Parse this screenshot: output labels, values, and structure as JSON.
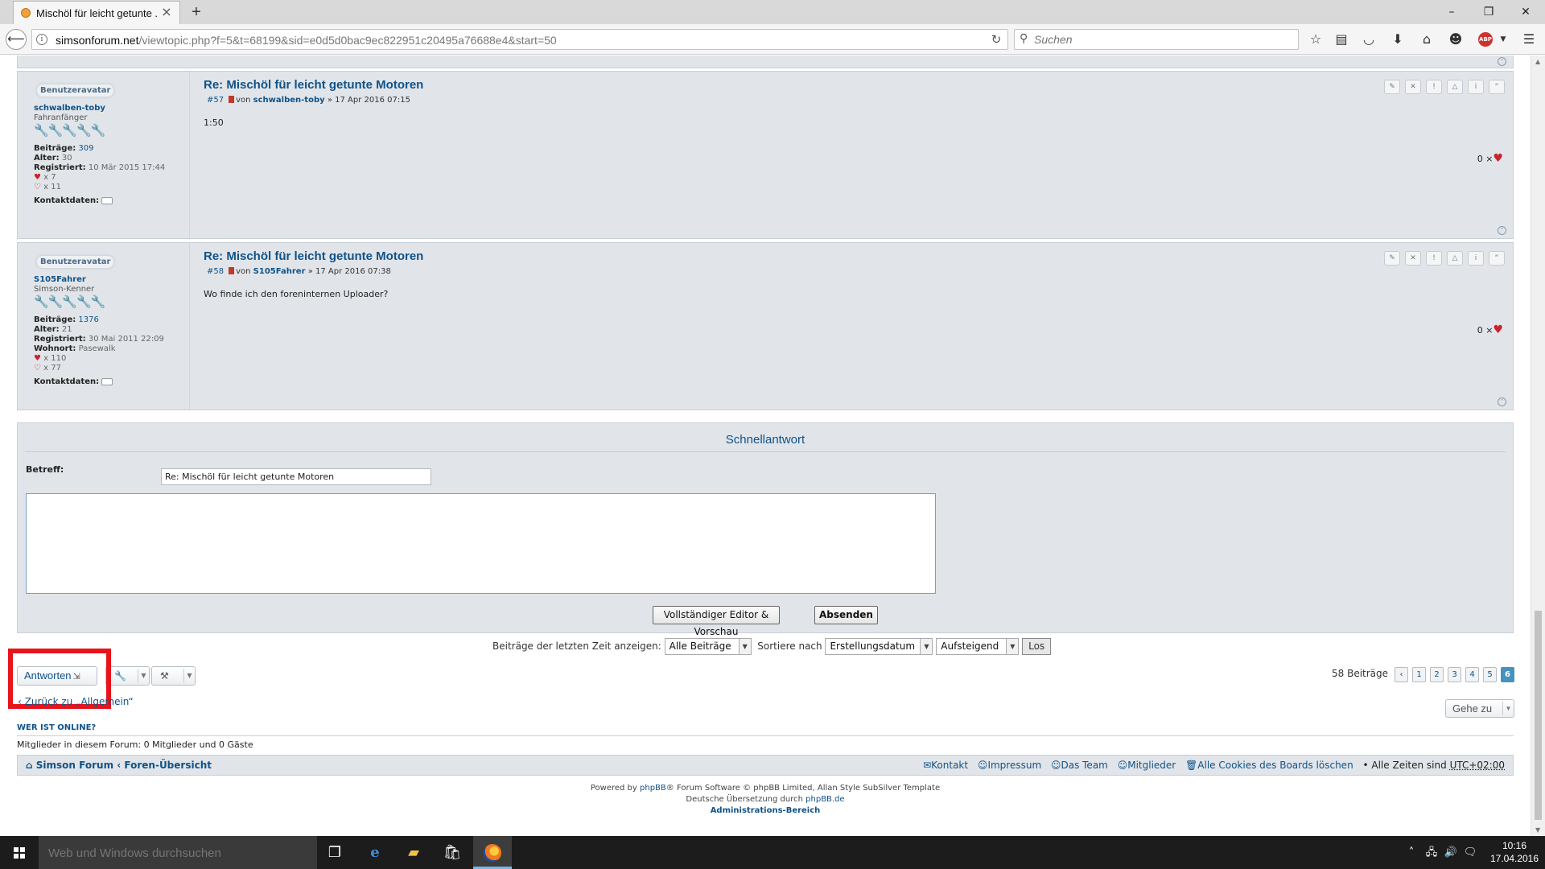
{
  "browser": {
    "tab_title": "Mischöl für leicht getunte ...",
    "url_host": "simsonforum.net",
    "url_path": "/viewtopic.php?f=5&t=68199&sid=e0d5d0bac9ec822951c20495a76688e4&start=50",
    "search_placeholder": "Suchen"
  },
  "posts": [
    {
      "avatar_label": "Benutzeravatar",
      "username": "schwalben-toby",
      "rank": "Fahranfänger",
      "rank_level": 2,
      "rank_max": 5,
      "beitraege_label": "Beiträge:",
      "beitraege": "309",
      "alter_label": "Alter:",
      "alter": "30",
      "registriert_label": "Registriert:",
      "registriert": "10 Mär 2015 17:44",
      "likes_given": "x 7",
      "likes_received": "x 11",
      "kontakt_label": "Kontaktdaten:",
      "title": "Re: Mischöl für leicht getunte Motoren",
      "number": "#57",
      "von": "von",
      "author": "schwalben-toby",
      "date": "» 17 Apr 2016 07:15",
      "body": "1:50",
      "like_count": "0 ×"
    },
    {
      "avatar_label": "Benutzeravatar",
      "username": "S105Fahrer",
      "rank": "Simson-Kenner",
      "rank_level": 4,
      "rank_max": 5,
      "beitraege_label": "Beiträge:",
      "beitraege": "1376",
      "alter_label": "Alter:",
      "alter": "21",
      "registriert_label": "Registriert:",
      "registriert": "30 Mai 2011 22:09",
      "wohnort_label": "Wohnort:",
      "wohnort": "Pasewalk",
      "likes_given": "x 110",
      "likes_received": "x 77",
      "kontakt_label": "Kontaktdaten:",
      "title": "Re: Mischöl für leicht getunte Motoren",
      "number": "#58",
      "von": "von",
      "author": "S105Fahrer",
      "date": "» 17 Apr 2016 07:38",
      "body": "Wo finde ich den foreninternen Uploader?",
      "like_count": "0 ×"
    }
  ],
  "quick_reply": {
    "title": "Schnellantwort",
    "subject_label": "Betreff:",
    "subject_value": "Re: Mischöl für leicht getunte Motoren",
    "message_value": "",
    "full_editor_label": "Vollständiger Editor & Vorschau",
    "submit_label": "Absenden"
  },
  "sort": {
    "show_label": "Beiträge der letzten Zeit anzeigen:",
    "show_value": "Alle Beiträge",
    "sort_label": "Sortiere nach",
    "sort_value": "Erstellungsdatum",
    "order_value": "Aufsteigend",
    "go_label": "Los"
  },
  "actions": {
    "reply_label": "Antworten",
    "post_count": "58 Beiträge",
    "pages": [
      "1",
      "2",
      "3",
      "4",
      "5",
      "6"
    ],
    "current_page": "6",
    "back_link": "‹ Zurück zu „Allgemein“",
    "goto_label": "Gehe zu"
  },
  "online": {
    "heading": "WER IST ONLINE?",
    "text": "Mitglieder in diesem Forum: 0 Mitglieder und 0 Gäste"
  },
  "footer": {
    "home": "Simson Forum",
    "index": "Foren-Übersicht",
    "links": [
      "Kontakt",
      "Impressum",
      "Das Team",
      "Mitglieder",
      "Alle Cookies des Boards löschen"
    ],
    "timezone_prefix": "• Alle Zeiten sind",
    "timezone": "UTC+02:00",
    "powered_pre": "Powered by",
    "powered_phpbb": "phpBB",
    "powered_post": "® Forum Software © phpBB Limited, Allan Style SubSilver Template",
    "translation_pre": "Deutsche Übersetzung durch",
    "translation_link": "phpBB.de",
    "admin": "Administrations-Bereich"
  },
  "taskbar": {
    "search_placeholder": "Web und Windows durchsuchen",
    "time": "10:16",
    "date": "17.04.2016"
  },
  "colors": {
    "link": "#105289",
    "post_bg": "#e1e5e9",
    "highlight": "#e8141b",
    "active_page": "#4692bf"
  }
}
